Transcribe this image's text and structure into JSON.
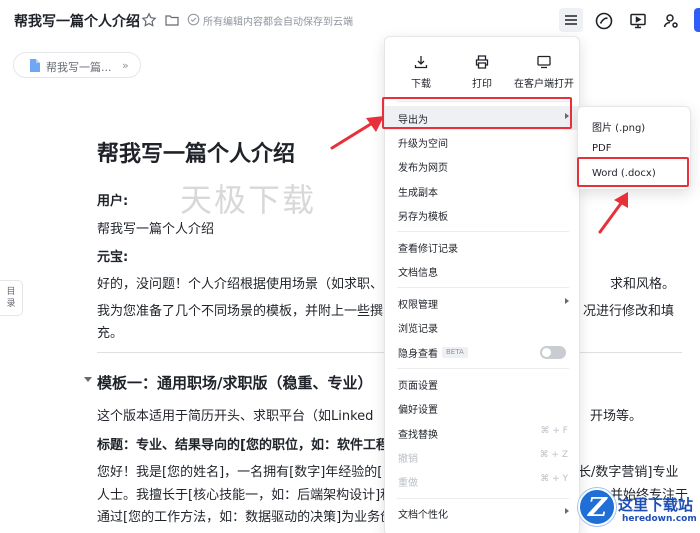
{
  "header": {
    "title": "帮我写一篇个人介绍",
    "save_status": "所有编辑内容都会自动保存到云端"
  },
  "breadcrumb": {
    "label": "帮我写一篇..."
  },
  "outline_tab": {
    "line1": "目",
    "line2": "录"
  },
  "document": {
    "heading": "帮我写一篇个人介绍",
    "watermark": "天极下载",
    "user_label": "用户:",
    "user_text": "帮我写一篇个人介绍",
    "bot_label": "元宝:",
    "p1_left": "好的，没问题！个人介绍根据使用场景（如求职、",
    "p1_right": "求和风格。",
    "p2_left": "我为您准备了几个不同场景的模板，并附上一些撰",
    "p2_right": "况进行修改和填",
    "p2_cont": "充。",
    "h2": "模板一：通用职场/求职版（稳重、专业）",
    "p3_left": "这个版本适用于简历开头、求职平台（如Linked",
    "p3_right": "开场等。",
    "p4_left": "标题：专业、结果导向的[您的职位，如：软件工程",
    "p5_left": "您好！我是[您的姓名]，一名拥有[数字]年经验的[",
    "p5_right": "长/数字营销]专业",
    "p6_left": "人士。我擅长于[核心技能一，如：后端架构设计]和",
    "p6_right": "，并始终专注于",
    "p7_left": "通过[您的工作方法，如：数据驱动的决策]为业务创"
  },
  "menu": {
    "quick": {
      "download": "下载",
      "print": "打印",
      "open_client": "在客户端打开"
    },
    "items": {
      "export_as": "导出为",
      "upgrade_space": "升级为空间",
      "publish_web": "发布为网页",
      "create_copy": "生成副本",
      "save_template": "另存为模板",
      "revision_history": "查看修订记录",
      "doc_info": "文档信息",
      "permissions": "权限管理",
      "browse_history": "浏览记录",
      "incognito": "隐身查看",
      "beta": "BETA",
      "page_setup": "页面设置",
      "preferences": "偏好设置",
      "find_replace": "查找替换",
      "undo": "撤销",
      "redo": "重做",
      "personalize": "文档个性化"
    },
    "shortcuts": {
      "find_replace": "⌘ + F",
      "undo": "⌘ + Z",
      "redo": "⌘ + Y"
    }
  },
  "submenu": {
    "png": "图片 (.png)",
    "pdf": "PDF",
    "word": "Word (.docx)"
  },
  "site_logo": {
    "letter": "Z",
    "name": "这里下载站",
    "url": "heredown.com"
  },
  "colors": {
    "highlight_red": "#e8303a",
    "accent_blue": "#2f5ff5",
    "logo_blue": "#1f6fd6"
  }
}
